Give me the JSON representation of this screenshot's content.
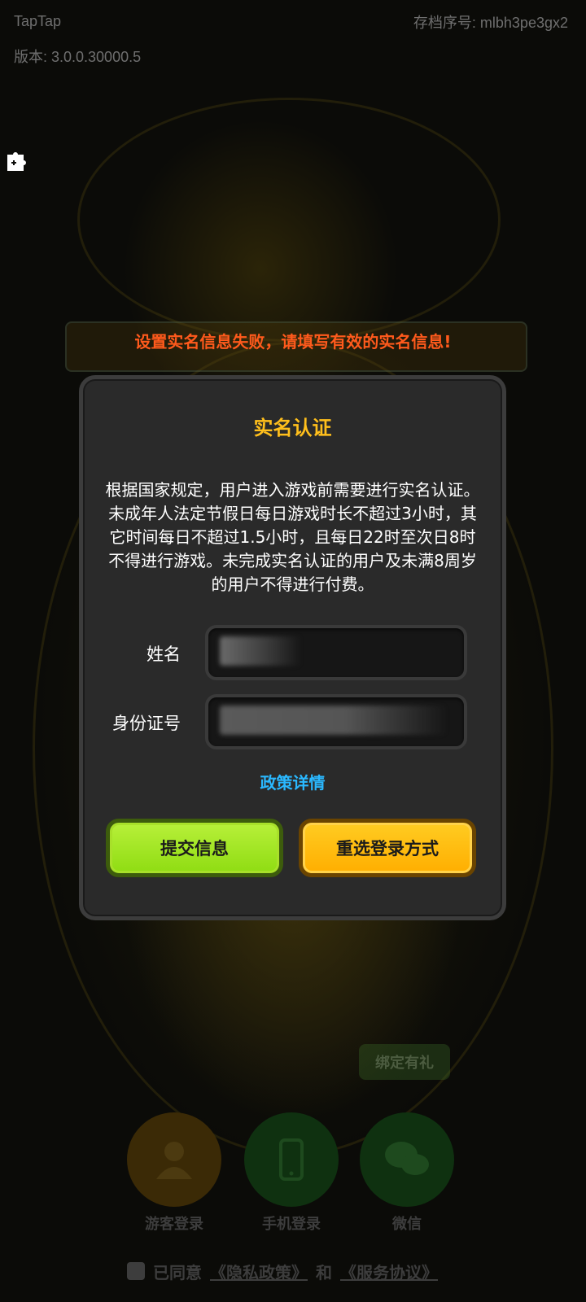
{
  "header": {
    "app_name": "TapTap",
    "version_label": "版本: 3.0.0.30000.5",
    "save_id_label": "存档序号: mlbh3pe3gx2"
  },
  "error_message": "设置实名信息失败，请填写有效的实名信息!",
  "dialog": {
    "title": "实名认证",
    "notice": "根据国家规定，用户进入游戏前需要进行实名认证。未成年人法定节假日每日游戏时长不超过3小时，其它时间每日不超过1.5小时，且每日22时至次日8时不得进行游戏。未完成实名认证的用户及未满8周岁的用户不得进行付费。",
    "name_label": "姓名",
    "id_label": "身份证号",
    "policy_link": "政策详情",
    "submit_button": "提交信息",
    "reselect_button": "重选登录方式"
  },
  "background": {
    "bind_gift": "绑定有礼",
    "login_options": [
      {
        "label": "游客登录",
        "icon": "person-icon"
      },
      {
        "label": "手机登录",
        "icon": "phone-icon"
      },
      {
        "label": "微信",
        "icon": "wechat-icon"
      }
    ],
    "agree_prefix": "已同意",
    "privacy_link": "《隐私政策》",
    "and_text": "和",
    "service_link": "《服务协议》"
  },
  "colors": {
    "error": "#ff5a1c",
    "title": "#ffbf1c",
    "link": "#2ab8ff",
    "submit_button": "#9ae21e",
    "reselect_button": "#ffb800"
  }
}
